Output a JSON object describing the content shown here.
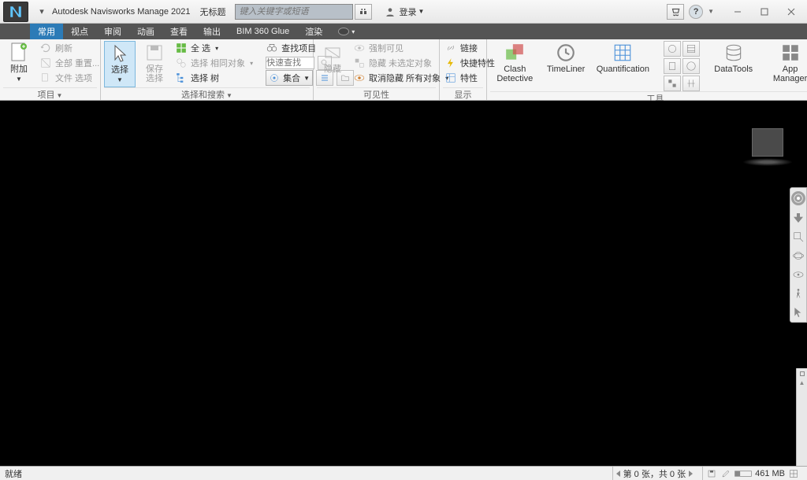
{
  "title": {
    "app": "Autodesk Navisworks Manage 2021",
    "doc": "无标题"
  },
  "search": {
    "placeholder": "键入关键字或短语",
    "login": "登录"
  },
  "tabs": {
    "items": [
      "常用",
      "视点",
      "审阅",
      "动画",
      "查看",
      "输出",
      "BIM 360 Glue",
      "渲染"
    ],
    "active_index": 0
  },
  "ribbon": {
    "panels": [
      {
        "label": "项目",
        "items": {
          "append": "附加",
          "refresh": "刷新",
          "reset_all": "全部 重置...",
          "file_options": "文件 选项"
        }
      },
      {
        "label": "选择和搜索",
        "items": {
          "select": "选择",
          "save_select": "保存选择",
          "select_all": "全 选",
          "select_same": "选择 相同对象",
          "select_tree": "选择 树",
          "find_items": "查找项目",
          "quick_find_placeholder": "快速查找",
          "sets": "集合"
        }
      },
      {
        "label": "可见性",
        "items": {
          "hide": "隐藏",
          "force_visible": "强制可见",
          "hide_unselected": "隐藏 未选定对象",
          "unhide_all": "取消隐藏 所有对象"
        }
      },
      {
        "label": "显示",
        "items": {
          "link": "链接",
          "quick_props": "快捷特性",
          "props": "特性"
        }
      },
      {
        "label": "工具",
        "items": {
          "clash": "Clash Detective",
          "timeliner": "TimeLiner",
          "quant": "Quantification",
          "datatools": "DataTools",
          "appmgr": "App Manager"
        }
      }
    ]
  },
  "status": {
    "ready": "就绪",
    "sheets": "第 0 张，共 0 张",
    "memory": "461 MB"
  }
}
